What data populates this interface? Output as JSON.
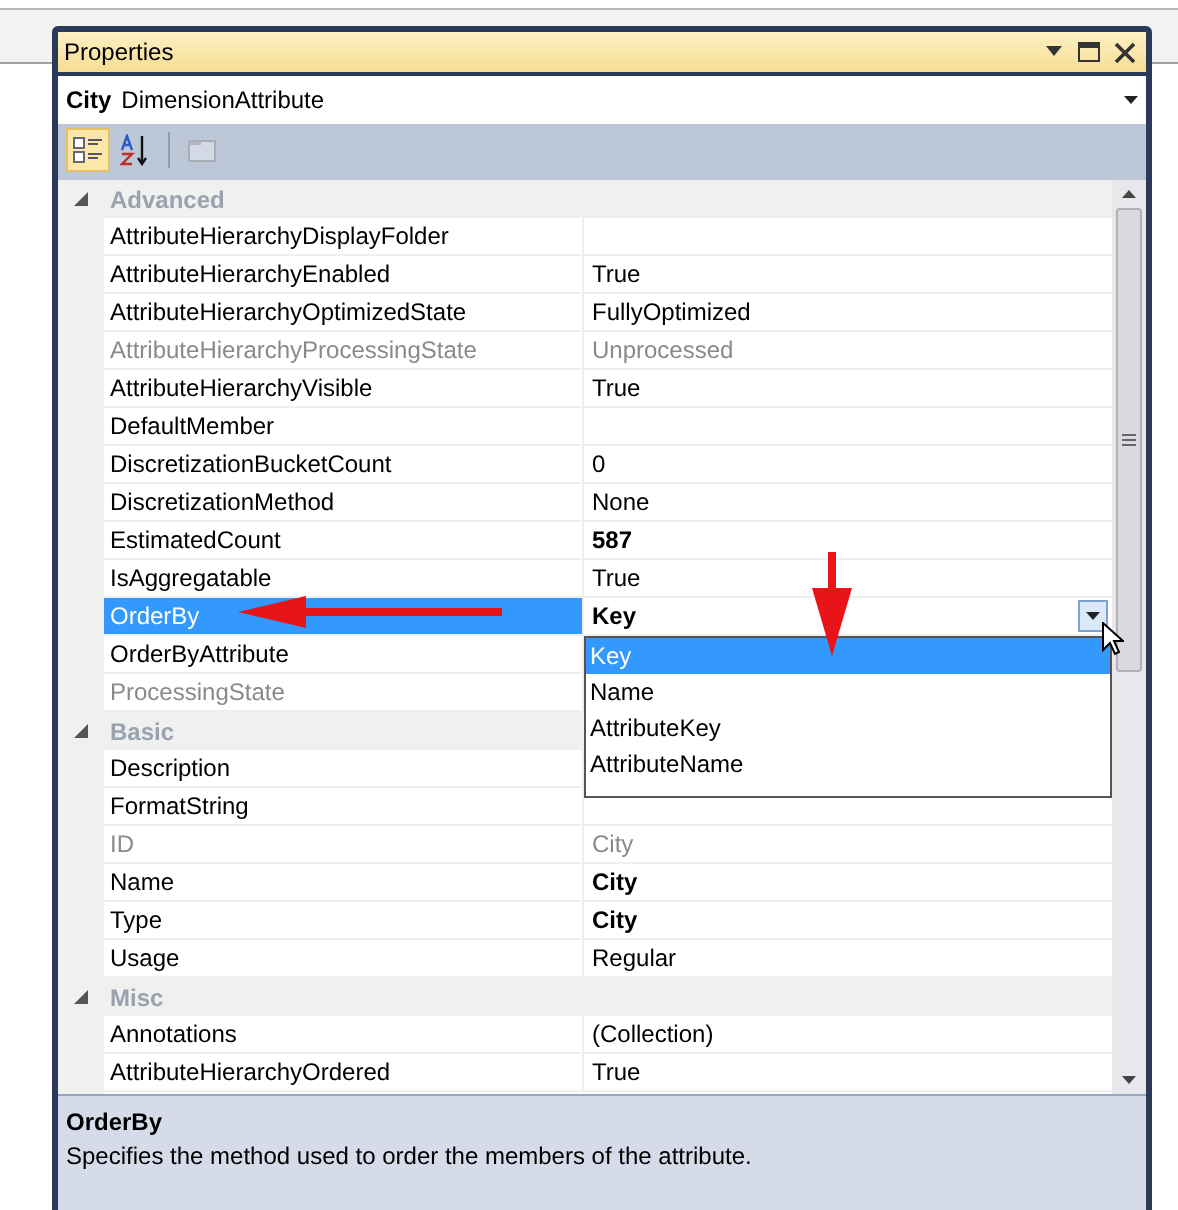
{
  "window": {
    "title": "Properties"
  },
  "object_selector": {
    "name": "City",
    "type": "DimensionAttribute"
  },
  "toolbar": [
    {
      "kind": "categorized",
      "selected": true,
      "disabled": false
    },
    {
      "kind": "alphabetical",
      "selected": false,
      "disabled": false
    },
    {
      "kind": "property-pages",
      "selected": false,
      "disabled": true
    }
  ],
  "grid": [
    {
      "kind": "category",
      "label": "Advanced",
      "expanded": true
    },
    {
      "kind": "property",
      "name": "AttributeHierarchyDisplayFolder",
      "disabled": false,
      "selected": false
    },
    {
      "kind": "property",
      "name": "AttributeHierarchyEnabled",
      "value": "True",
      "disabled": false,
      "selected": false
    },
    {
      "kind": "property",
      "name": "AttributeHierarchyOptimizedState",
      "value": "FullyOptimized",
      "disabled": false,
      "selected": false
    },
    {
      "kind": "property",
      "name": "AttributeHierarchyProcessingState",
      "value": "Unprocessed",
      "disabled": true,
      "selected": false
    },
    {
      "kind": "property",
      "name": "AttributeHierarchyVisible",
      "value": "True",
      "disabled": false,
      "selected": false
    },
    {
      "kind": "property",
      "name": "DefaultMember",
      "disabled": false,
      "selected": false
    },
    {
      "kind": "property",
      "name": "DiscretizationBucketCount",
      "value": "0",
      "disabled": false,
      "selected": false
    },
    {
      "kind": "property",
      "name": "DiscretizationMethod",
      "value": "None",
      "disabled": false,
      "selected": false
    },
    {
      "kind": "property",
      "name": "EstimatedCount",
      "value": "587",
      "disabled": false,
      "bold": true,
      "selected": false
    },
    {
      "kind": "property",
      "name": "IsAggregatable",
      "value": "True",
      "disabled": false,
      "selected": false
    },
    {
      "kind": "property",
      "name": "OrderBy",
      "value": "Key",
      "disabled": false,
      "bold": true,
      "selected": true,
      "dropdown": [
        {
          "label": "Key",
          "selected": true
        },
        {
          "label": "Name",
          "selected": false
        },
        {
          "label": "AttributeKey",
          "selected": false
        },
        {
          "label": "AttributeName",
          "selected": false
        }
      ]
    },
    {
      "kind": "property",
      "name": "OrderByAttribute",
      "disabled": false,
      "selected": false
    },
    {
      "kind": "property",
      "name": "ProcessingState",
      "disabled": true,
      "selected": false
    },
    {
      "kind": "category",
      "label": "Basic",
      "expanded": true
    },
    {
      "kind": "property",
      "name": "Description",
      "disabled": false,
      "selected": false
    },
    {
      "kind": "property",
      "name": "FormatString",
      "disabled": false,
      "selected": false
    },
    {
      "kind": "property",
      "name": "ID",
      "value": "City",
      "disabled": true,
      "selected": false
    },
    {
      "kind": "property",
      "name": "Name",
      "value": "City",
      "disabled": false,
      "bold": true,
      "selected": false
    },
    {
      "kind": "property",
      "name": "Type",
      "value": "City",
      "disabled": false,
      "bold": true,
      "selected": false
    },
    {
      "kind": "property",
      "name": "Usage",
      "value": "Regular",
      "disabled": false,
      "selected": false
    },
    {
      "kind": "category",
      "label": "Misc",
      "expanded": true
    },
    {
      "kind": "property",
      "name": "Annotations",
      "value": "(Collection)",
      "disabled": false,
      "selected": false
    },
    {
      "kind": "property",
      "name": "AttributeHierarchyOrdered",
      "value": "True",
      "disabled": false,
      "selected": false
    }
  ],
  "description": {
    "title": "OrderBy",
    "text": "Specifies the method used to order the members of the attribute."
  }
}
